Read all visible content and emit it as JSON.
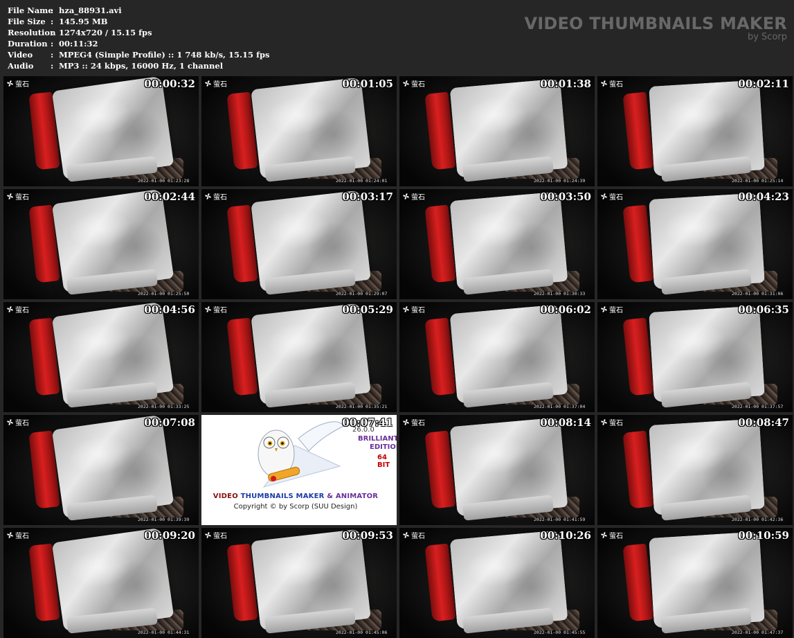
{
  "file_info": [
    {
      "label": "File Name",
      "value": "hza_88931.avi"
    },
    {
      "label": "File Size",
      "value": "145.95 MB"
    },
    {
      "label": "Resolution",
      "value": "1274x720 / 15.15 fps"
    },
    {
      "label": "Duration",
      "value": "00:11:32"
    },
    {
      "label": "Video",
      "value": "MPEG4 (Simple Profile) :: 1 748 kb/s, 15.15 fps"
    },
    {
      "label": "Audio",
      "value": "MP3 :: 24 kbps, 16000 Hz, 1 channel"
    }
  ],
  "separator": ":",
  "brand": {
    "title": "VIDEO THUMBNAILS MAKER",
    "subtitle": "by Scorp"
  },
  "thumb_logo": "萤石",
  "thumbnails": [
    {
      "time": "00:00:32",
      "stamp": "2022-01-00 01:23:28"
    },
    {
      "time": "00:01:05",
      "stamp": "2022-01-00 01:24:01"
    },
    {
      "time": "00:01:38",
      "stamp": "2022-01-00 01:24:39"
    },
    {
      "time": "00:02:11",
      "stamp": "2022-01-00 01:25:14"
    },
    {
      "time": "00:02:44",
      "stamp": "2022-01-00 01:25:50"
    },
    {
      "time": "00:03:17",
      "stamp": "2022-01-00 01:29:07"
    },
    {
      "time": "00:03:50",
      "stamp": "2022-01-00 01:30:33"
    },
    {
      "time": "00:04:23",
      "stamp": "2022-01-00 01:31:06"
    },
    {
      "time": "00:04:56",
      "stamp": "2022-01-00 01:33:25"
    },
    {
      "time": "00:05:29",
      "stamp": "2022-01-00 01:35:21"
    },
    {
      "time": "00:06:02",
      "stamp": "2022-01-00 01:37:04"
    },
    {
      "time": "00:06:35",
      "stamp": "2022-01-00 01:37:57"
    },
    {
      "time": "00:07:08",
      "stamp": "2022-01-00 01:39:39"
    },
    {
      "time": "00:07:41",
      "ad": true
    },
    {
      "time": "00:08:14",
      "stamp": "2022-01-00 01:41:59"
    },
    {
      "time": "00:08:47",
      "stamp": "2022-01-00 01:42:36"
    },
    {
      "time": "00:09:20",
      "stamp": "2022-01-00 01:44:31"
    },
    {
      "time": "00:09:53",
      "stamp": "2022-01-00 01:45:06"
    },
    {
      "time": "00:10:26",
      "stamp": "2022-01-00 01:45:55"
    },
    {
      "time": "00:10:59",
      "stamp": "2022-01-00 01:47:37"
    }
  ],
  "ad": {
    "version": "26.0.0",
    "edition_line1": "BRILLIANT",
    "edition_line2": "EDITION",
    "bits": "64 BIT",
    "title_part1": "VIDEO",
    "title_part2": "THUMBNAILS MAKER",
    "title_part3": "& ANIMATOR",
    "copyright": "Copyright © by Scorp (SUU Design)"
  }
}
